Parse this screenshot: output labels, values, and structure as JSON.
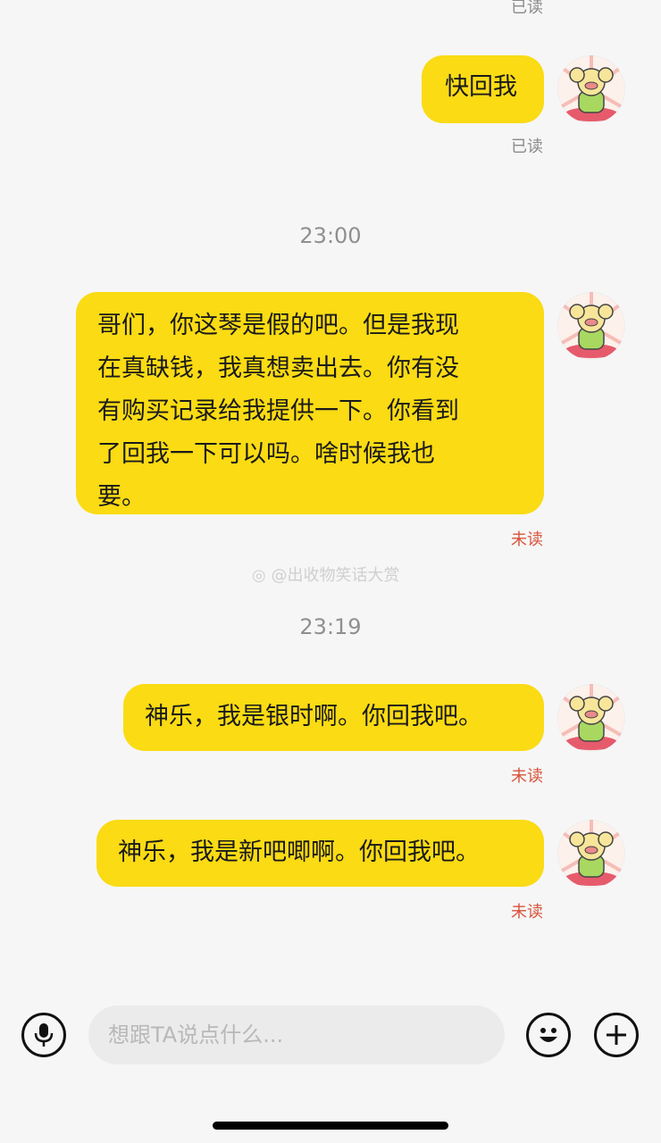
{
  "messages": [
    {
      "text": "快回我",
      "status": "已读"
    },
    {
      "text": "哥们，你这琴是假的吧。但是我现在真缺钱，我真想卖出去。你有没有购买记录给我提供一下。你看到了回我一下可以吗。啥时候我也要。",
      "lines": [
        "哥们，你这琴是假的吧。但是我现",
        "在真缺钱，我真想卖出去。你有没",
        "有购买记录给我提供一下。你看到",
        "了回我一下可以吗。啥时候我也",
        "要。"
      ],
      "status": "未读"
    },
    {
      "text": "神乐，我是银时啊。你回我吧。",
      "status": "未读"
    },
    {
      "text": "神乐，我是新吧唧啊。你回我吧。",
      "status": "未读"
    }
  ],
  "top_status": "已读",
  "timestamps": [
    "23:00",
    "23:19"
  ],
  "watermark": "@出收物笑话大赏",
  "input": {
    "placeholder": "想跟TA说点什么..."
  },
  "icons": {
    "voice": "microphone-icon",
    "emoji": "emoji-icon",
    "more": "plus-icon"
  },
  "colors": {
    "bubble": "#fadb14",
    "unread": "#d9533a",
    "read": "#8a8a8a",
    "background": "#f6f6f6"
  }
}
